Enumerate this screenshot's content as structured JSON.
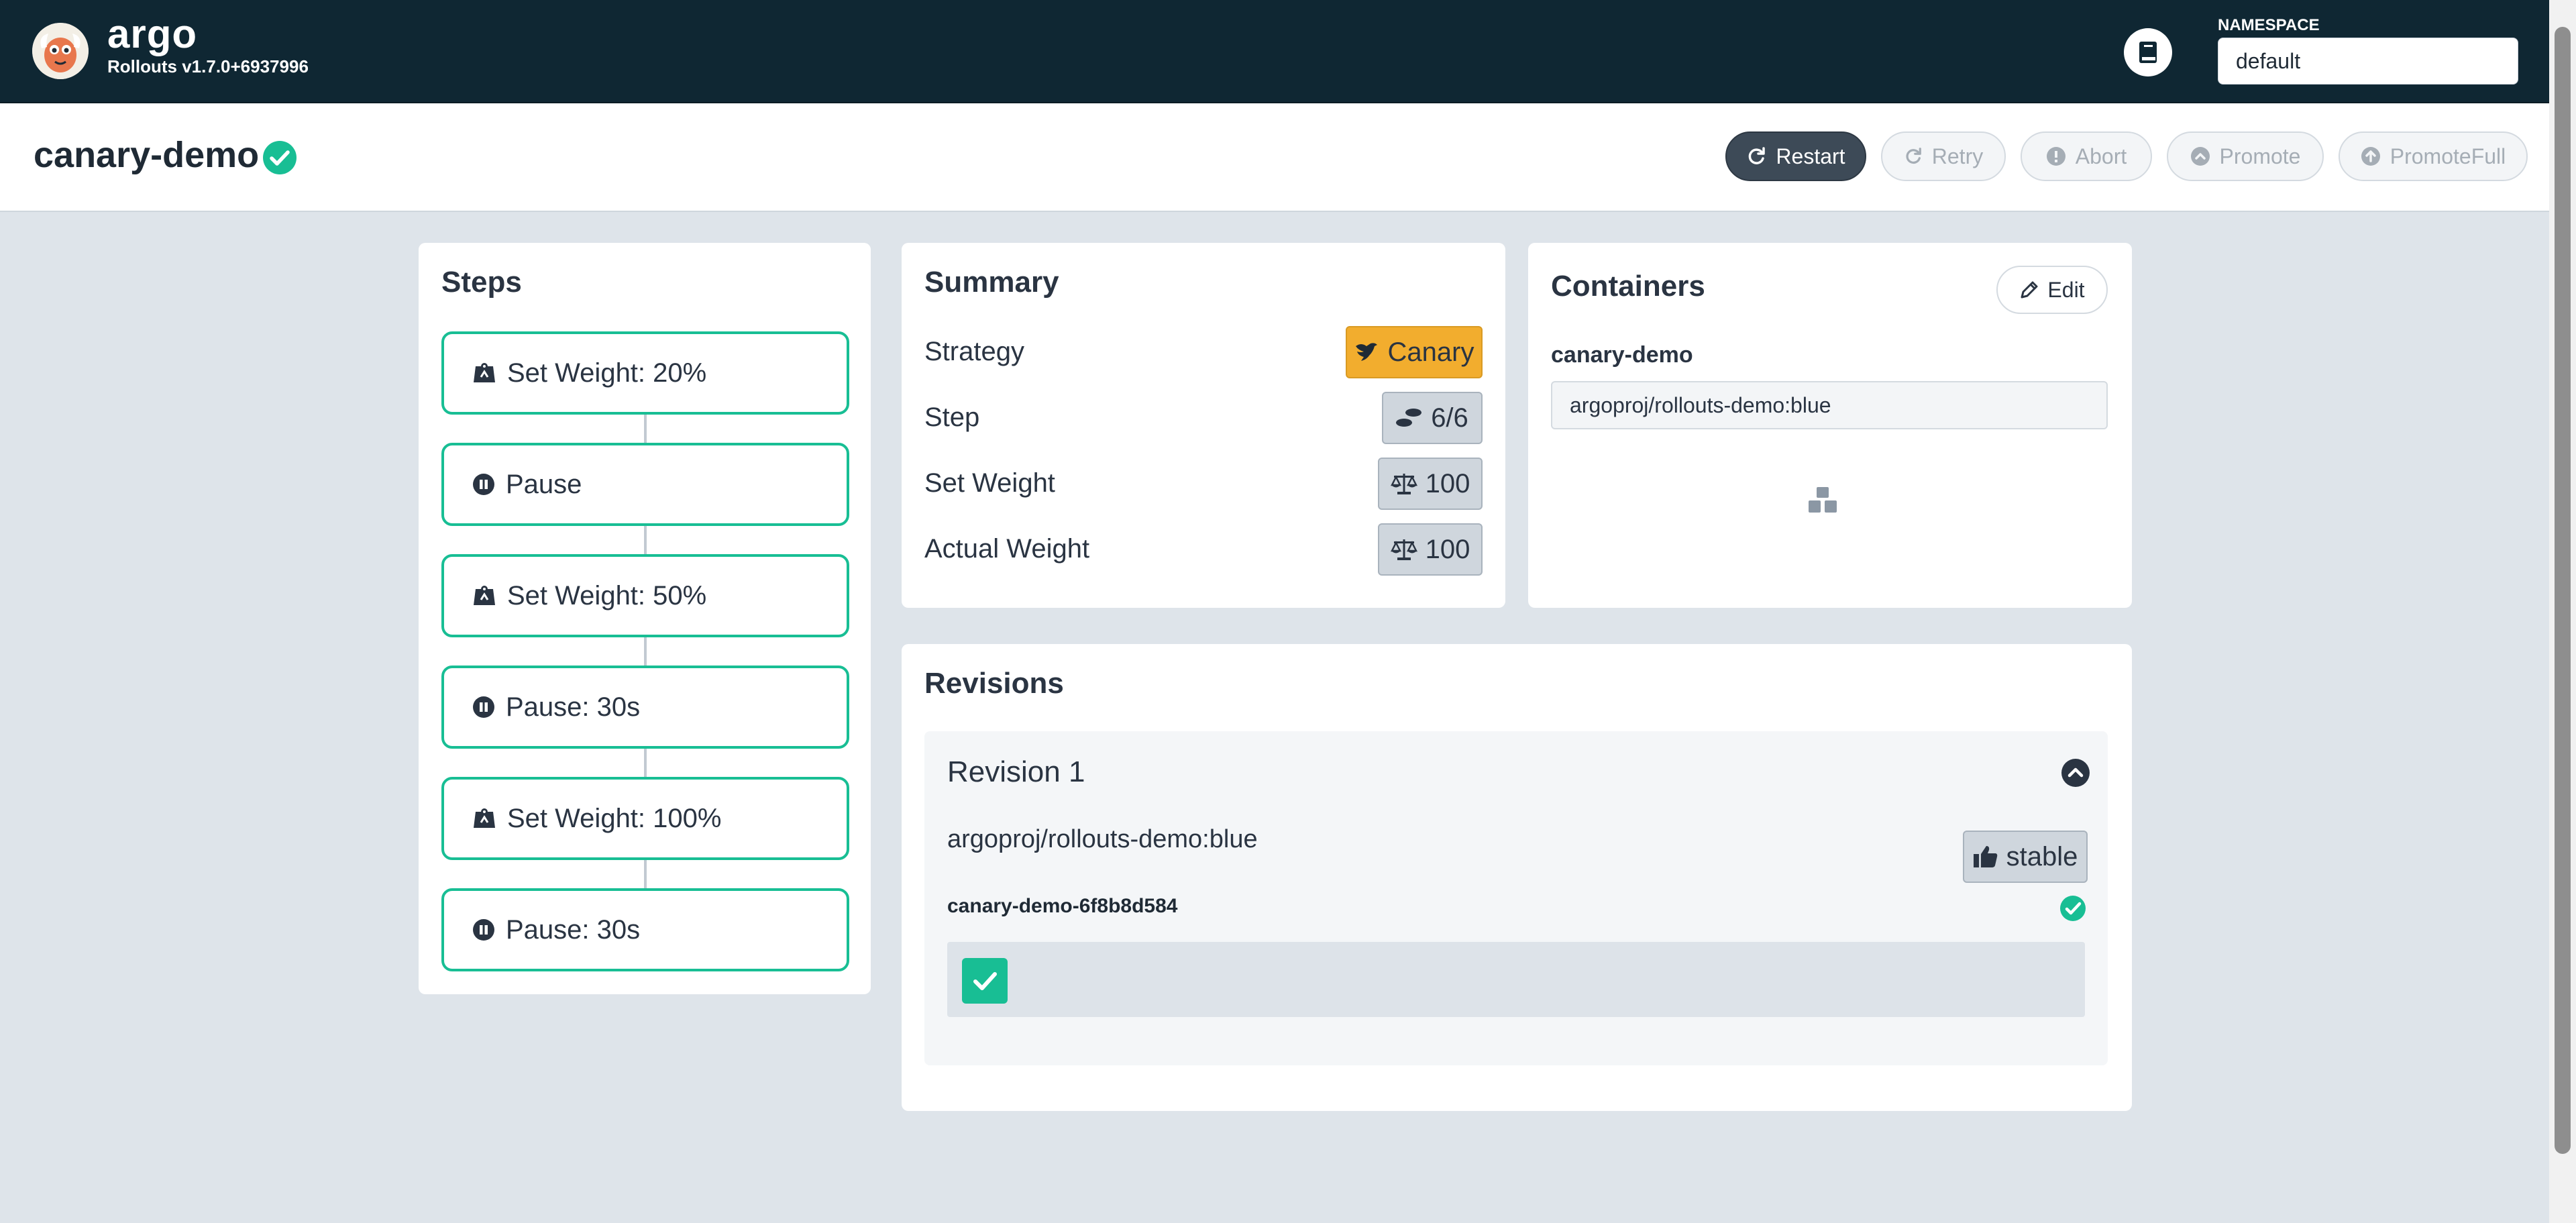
{
  "topbar": {
    "brand": "argo",
    "version": "Rollouts v1.7.0+6937996",
    "namespace_label": "NAMESPACE",
    "namespace_value": "default"
  },
  "header": {
    "title": "canary-demo",
    "actions": {
      "restart": "Restart",
      "retry": "Retry",
      "abort": "Abort",
      "promote": "Promote",
      "promote_full": "PromoteFull"
    }
  },
  "steps": {
    "title": "Steps",
    "items": [
      {
        "label": "Set Weight: 20%",
        "icon": "weight-icon"
      },
      {
        "label": "Pause",
        "icon": "pause-icon"
      },
      {
        "label": "Set Weight: 50%",
        "icon": "weight-icon"
      },
      {
        "label": "Pause: 30s",
        "icon": "pause-icon"
      },
      {
        "label": "Set Weight: 100%",
        "icon": "weight-icon"
      },
      {
        "label": "Pause: 30s",
        "icon": "pause-icon"
      }
    ]
  },
  "summary": {
    "title": "Summary",
    "strategy_label": "Strategy",
    "strategy_value": "Canary",
    "step_label": "Step",
    "step_value": "6/6",
    "set_weight_label": "Set Weight",
    "set_weight_value": "100",
    "actual_weight_label": "Actual Weight",
    "actual_weight_value": "100"
  },
  "containers": {
    "title": "Containers",
    "edit_label": "Edit",
    "name": "canary-demo",
    "image": "argoproj/rollouts-demo:blue"
  },
  "revisions": {
    "title": "Revisions",
    "items": [
      {
        "title": "Revision 1",
        "image": "argoproj/rollouts-demo:blue",
        "badge": "stable",
        "replicaset": "canary-demo-6f8b8d584"
      }
    ]
  },
  "colors": {
    "topbar": "#0f2733",
    "accent_green": "#18be94",
    "canary_orange": "#f2ad2e",
    "background": "#dee4ea"
  }
}
